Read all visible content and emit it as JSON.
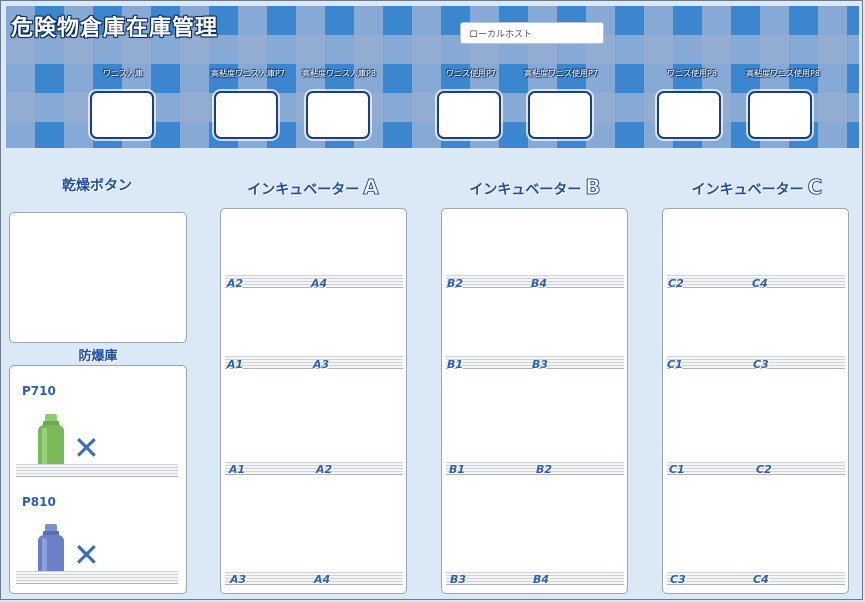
{
  "app": {
    "title": "危険物倉庫在庫管理"
  },
  "host": {
    "value": "ローカルホスト"
  },
  "controls": [
    {
      "label": "ワニス入庫"
    },
    {
      "label": "高粘度ワニス入庫P7"
    },
    {
      "label": "高粘度ワニス入庫P8"
    },
    {
      "label": "ワニス使用P7"
    },
    {
      "label": "高粘度ワニス使用P7"
    },
    {
      "label": "ワニス使用P8"
    },
    {
      "label": "高粘度ワニス使用P8"
    }
  ],
  "sections": {
    "dry": {
      "title": "乾燥ボタン"
    },
    "explosion_proof": {
      "title": "防爆庫"
    },
    "incubator_a": {
      "title": "インキュベーター",
      "letter": "A"
    },
    "incubator_b": {
      "title": "インキュベーター",
      "letter": "B"
    },
    "incubator_c": {
      "title": "インキュベーター",
      "letter": "C"
    }
  },
  "products": [
    {
      "name": "P710",
      "status_icon": "cross-icon",
      "bottle_color": "#7ab85a"
    },
    {
      "name": "P810",
      "status_icon": "cross-icon",
      "bottle_color": "#6a7fc6"
    }
  ],
  "incubators": {
    "a": [
      [
        "A2",
        "A4"
      ],
      [
        "A1",
        "A3"
      ],
      [
        "A1",
        "A2"
      ],
      [
        "A3",
        "A4"
      ]
    ],
    "b": [
      [
        "B2",
        "B4"
      ],
      [
        "B1",
        "B3"
      ],
      [
        "B1",
        "B2"
      ],
      [
        "B3",
        "B4"
      ]
    ],
    "c": [
      [
        "C2",
        "C4"
      ],
      [
        "C1",
        "C3"
      ],
      [
        "C1",
        "C2"
      ],
      [
        "C3",
        "C4"
      ]
    ]
  },
  "colors": {
    "accent": "#1f4f99",
    "header": "#3b86cf",
    "background": "#dbe8f5"
  }
}
